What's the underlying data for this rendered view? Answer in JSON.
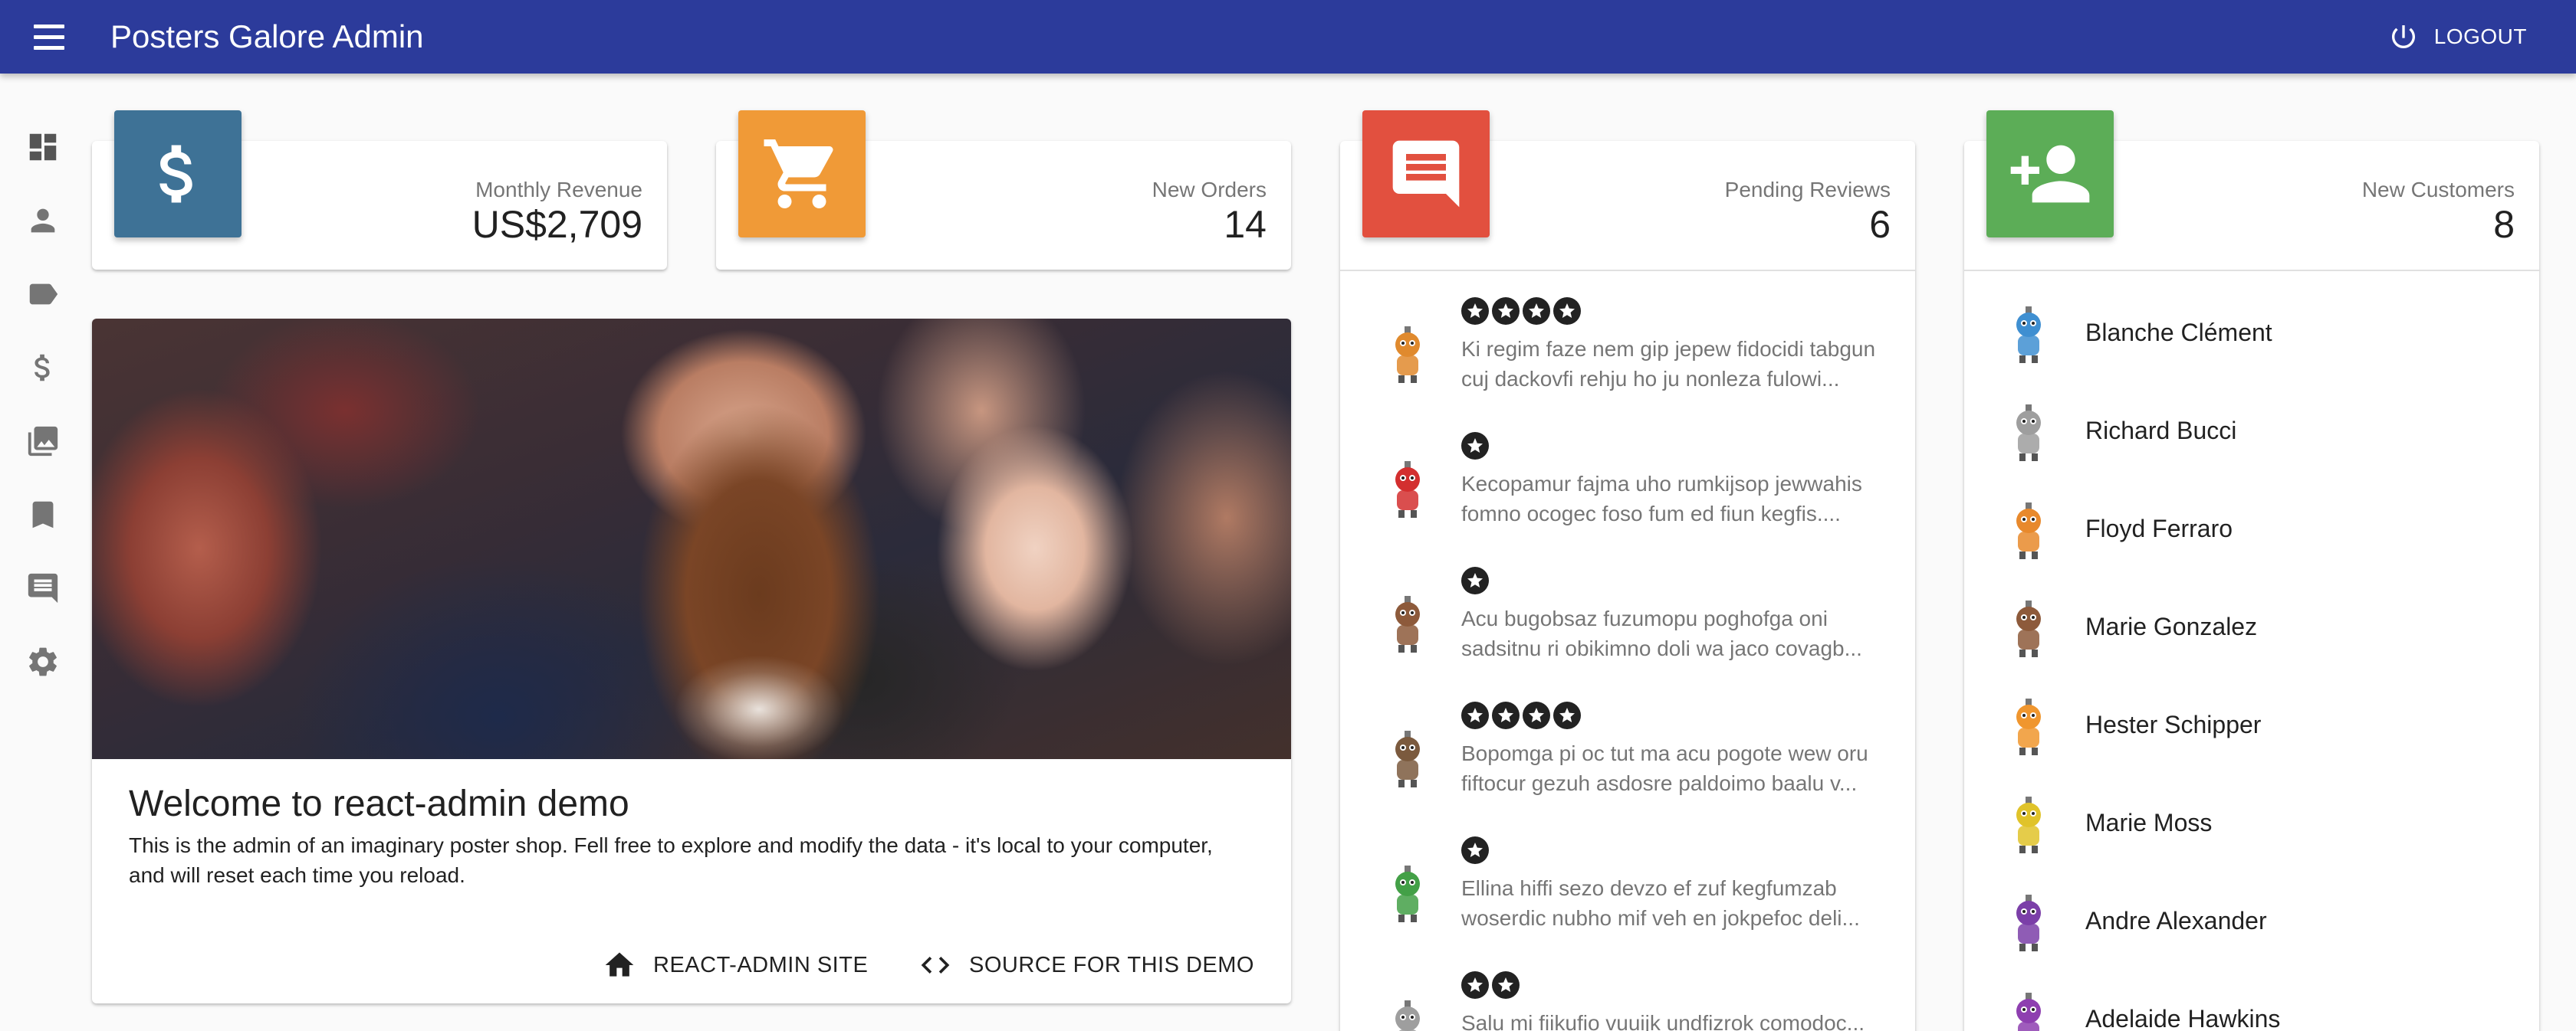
{
  "app": {
    "title": "Posters Galore Admin",
    "logout_label": "LOGOUT"
  },
  "colors": {
    "appbar": "#2c3b9b",
    "revenue": "#3e7296",
    "orders": "#f09a37",
    "reviews": "#e2503f",
    "customers": "#5cad57"
  },
  "sidebar": {
    "items": [
      {
        "icon": "dashboard-icon"
      },
      {
        "icon": "person-icon"
      },
      {
        "icon": "label-icon"
      },
      {
        "icon": "dollar-icon"
      },
      {
        "icon": "photo-library-icon"
      },
      {
        "icon": "bookmark-icon"
      },
      {
        "icon": "comment-icon"
      },
      {
        "icon": "gear-icon"
      }
    ]
  },
  "stats": {
    "revenue": {
      "label": "Monthly Revenue",
      "value": "US$2,709",
      "icon": "dollar-icon"
    },
    "orders": {
      "label": "New Orders",
      "value": "14",
      "icon": "cart-icon"
    },
    "reviews": {
      "label": "Pending Reviews",
      "value": "6",
      "icon": "comment-icon"
    },
    "customers": {
      "label": "New Customers",
      "value": "8",
      "icon": "person-add-icon"
    }
  },
  "welcome": {
    "title": "Welcome to react-admin demo",
    "text": "This is the admin of an imaginary poster shop. Fell free to explore and modify the data - it's local to your computer, and will reset each time you reload.",
    "site_label": "REACT-ADMIN SITE",
    "source_label": "SOURCE FOR THIS DEMO"
  },
  "reviews": [
    {
      "rating": 4,
      "comment": "Ki regim faze nem gip jepew fidocidi tabgun cuj dackovfi rehju ho ju nonleza fulowi...",
      "avatar_color": "#e08a2e"
    },
    {
      "rating": 1,
      "comment": "Kecopamur fajma uho rumkijsop jewwahis fomno ocogec foso fum ed fiun kegfis....",
      "avatar_color": "#d32f2f"
    },
    {
      "rating": 1,
      "comment": "Acu bugobsaz fuzumopu poghofga oni sadsitnu ri obikimno doli wa jaco covagb...",
      "avatar_color": "#8d5a3b"
    },
    {
      "rating": 4,
      "comment": "Bopomga pi oc tut ma acu pogote wew oru fiftocur gezuh asdosre paldoimo baalu v...",
      "avatar_color": "#7b5a3e"
    },
    {
      "rating": 1,
      "comment": "Ellina hiffi sezo devzo ef zuf kegfumzab woserdic nubho mif veh en jokpefoc deli...",
      "avatar_color": "#43a047"
    },
    {
      "rating": 2,
      "comment": "Salu mi fiikufio vuuijk undfizrok comodoc...",
      "avatar_color": "#9e9e9e"
    }
  ],
  "customers": [
    {
      "name": "Blanche Clément",
      "avatar_color": "#3f8fd1"
    },
    {
      "name": "Richard Bucci",
      "avatar_color": "#9e9e9e"
    },
    {
      "name": "Floyd Ferraro",
      "avatar_color": "#e8892c"
    },
    {
      "name": "Marie Gonzalez",
      "avatar_color": "#8d5a3b"
    },
    {
      "name": "Hester Schipper",
      "avatar_color": "#f0962e"
    },
    {
      "name": "Marie Moss",
      "avatar_color": "#e0c32a"
    },
    {
      "name": "Andre Alexander",
      "avatar_color": "#7b3fa8"
    },
    {
      "name": "Adelaide Hawkins",
      "avatar_color": "#8e3fb0"
    }
  ]
}
